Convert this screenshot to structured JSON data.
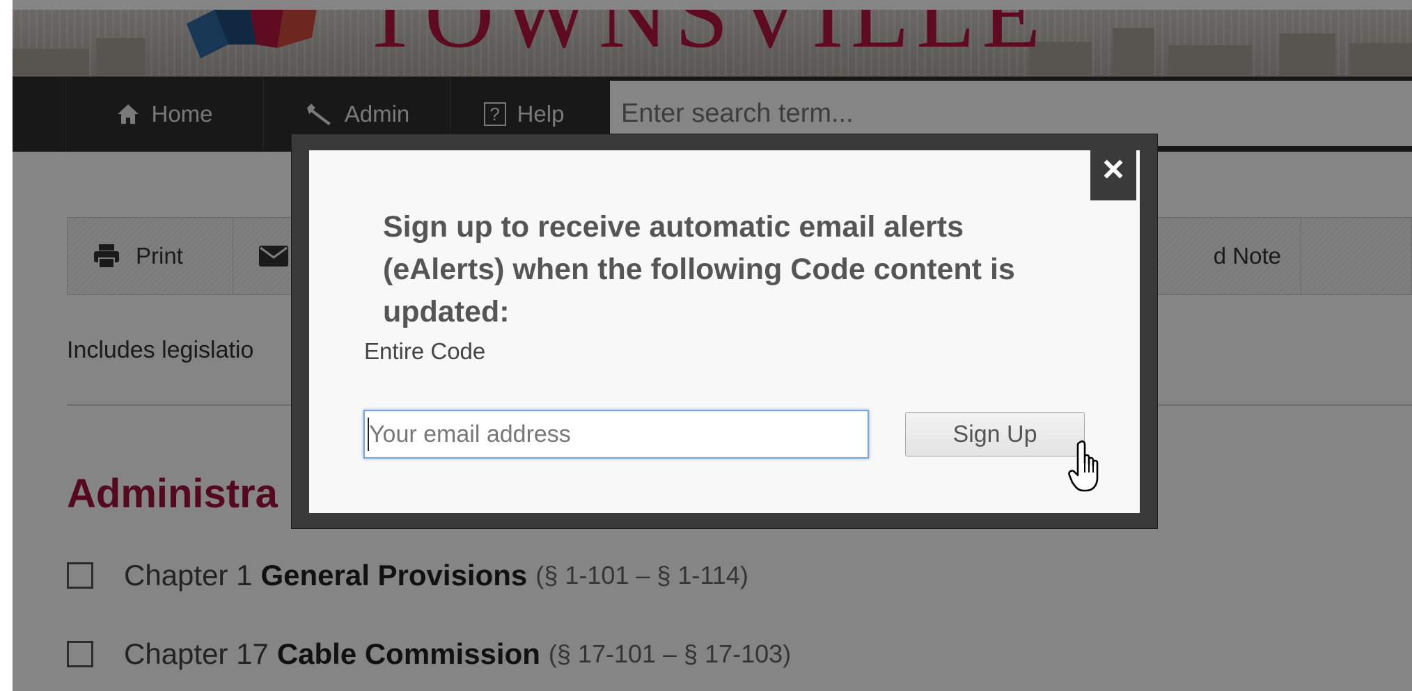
{
  "site": {
    "name": "TOWNSVILLE"
  },
  "nav": {
    "home_label": "Home",
    "admin_label": "Admin",
    "help_label": "Help",
    "help_icon_glyph": "?",
    "search_placeholder": "Enter search term..."
  },
  "toolbar": {
    "print_label": "Print",
    "note_label": "d Note"
  },
  "content": {
    "includes_text": "Includes legislatio",
    "section_title": "Administra",
    "chapters": [
      {
        "prefix": "Chapter 1",
        "title": "General Provisions",
        "range": "(§ 1-101 – § 1-114)"
      },
      {
        "prefix": "Chapter 17",
        "title": "Cable Commission",
        "range": "(§ 17-101 – § 17-103)"
      }
    ]
  },
  "modal": {
    "close_glyph": "×",
    "heading": "Sign up to receive automatic email alerts (eAlerts) when the following Code content is updated:",
    "scope_label": "Entire Code",
    "email_placeholder": "Your email address",
    "email_value": "",
    "signup_label": "Sign Up"
  },
  "colors": {
    "brand": "#b4153f",
    "nav_background": "#2f2f2f",
    "section_title": "#a3123a",
    "modal_frame": "#3a3a3a",
    "input_focus": "#7aa6dd"
  },
  "icons": [
    "home-icon",
    "wrench-icon",
    "help-icon",
    "print-icon",
    "envelope-icon",
    "close-icon",
    "hand-pointer-cursor"
  ]
}
